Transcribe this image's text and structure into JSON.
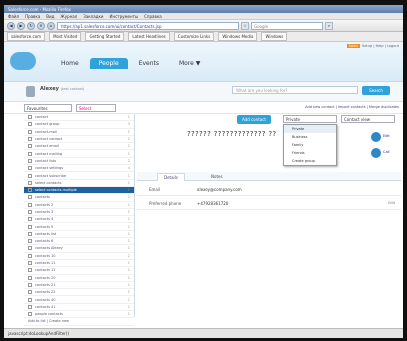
{
  "browser": {
    "title": "Salesforce.com - Mozilla Firefox",
    "menu": [
      "Файл",
      "Правка",
      "Вид",
      "Журнал",
      "Закладки",
      "Инструменты",
      "Справка"
    ],
    "address": "https://ap1.salesforce.com/ui/contact/Contacts.jsp",
    "web_search_placeholder": "Google",
    "bookmarks": [
      "salesforce.com",
      "Most Visited",
      "Getting Started",
      "Latest Headlines",
      "Customize Links",
      "Windows Media",
      "Windows"
    ],
    "status_text": "javascript:doLookupAndFilter()"
  },
  "app": {
    "toplinks_badge": "Sales",
    "toplinks": "Setup | Help | Logout",
    "tabs": [
      "Home",
      "People",
      "Events",
      "More"
    ],
    "active_tab": "People",
    "more_arrow": "▼"
  },
  "profile": {
    "name": "Alexey",
    "sub": "(test contact)",
    "search_placeholder": "What are you looking for?",
    "search_button": "Search"
  },
  "filters": {
    "view_select": "Favourites",
    "second_select": "Select",
    "links": "Add new contact | Import contacts | Merge duplicates"
  },
  "sidebar": {
    "items": [
      {
        "label": "contact",
        "count": "1"
      },
      {
        "label": "contact group",
        "count": "3"
      },
      {
        "label": "contact-mail",
        "count": "1"
      },
      {
        "label": "contact contact",
        "count": "2"
      },
      {
        "label": "contact email",
        "count": "1"
      },
      {
        "label": "contact mailing",
        "count": "1"
      },
      {
        "label": "contact lists",
        "count": "2"
      },
      {
        "label": "contact settings",
        "count": "4"
      },
      {
        "label": "contact subscribe",
        "count": "1"
      },
      {
        "label": "select contacts",
        "count": "1"
      },
      {
        "label": "select contacts multiple",
        "count": "1",
        "selected": true
      },
      {
        "label": "contacts",
        "count": "2"
      },
      {
        "label": "contacts 2",
        "count": "1"
      },
      {
        "label": "contacts 3",
        "count": "1"
      },
      {
        "label": "contacts 4",
        "count": "1"
      },
      {
        "label": "contacts 5",
        "count": "1"
      },
      {
        "label": "contacts list",
        "count": "1"
      },
      {
        "label": "contacts 6",
        "count": "1"
      },
      {
        "label": "contacts Alexey",
        "count": "1"
      },
      {
        "label": "contacts 10",
        "count": "2"
      },
      {
        "label": "contacts 11",
        "count": "1"
      },
      {
        "label": "contacts 12",
        "count": "1"
      },
      {
        "label": "contacts 20",
        "count": "1"
      },
      {
        "label": "contacts 21",
        "count": "1"
      },
      {
        "label": "contacts 22",
        "count": "1"
      },
      {
        "label": "contacts 40",
        "count": "1"
      },
      {
        "label": "contacts 41",
        "count": "1"
      },
      {
        "label": "people contacts",
        "count": "1"
      }
    ],
    "footer": "Add to list | Create new"
  },
  "contact": {
    "add_button": "Add contact",
    "dropdown_head": "Private",
    "dropdown_items": [
      "Private",
      "Business",
      "Family",
      "Friends",
      "Create group"
    ],
    "dropdown_top": "Contact view",
    "name": "?????? ????????????? ??",
    "actions": [
      "Edit",
      "Call"
    ],
    "subtabs": [
      "Details",
      "Notes"
    ],
    "fields": [
      {
        "label": "Email",
        "value": "alexey@company.com"
      },
      {
        "label": "Preferred phone",
        "value": "+47928361720",
        "edit": "Edit"
      }
    ]
  },
  "colors": {
    "accent": "#2fa3d9",
    "selected": "#1d5f9f"
  }
}
